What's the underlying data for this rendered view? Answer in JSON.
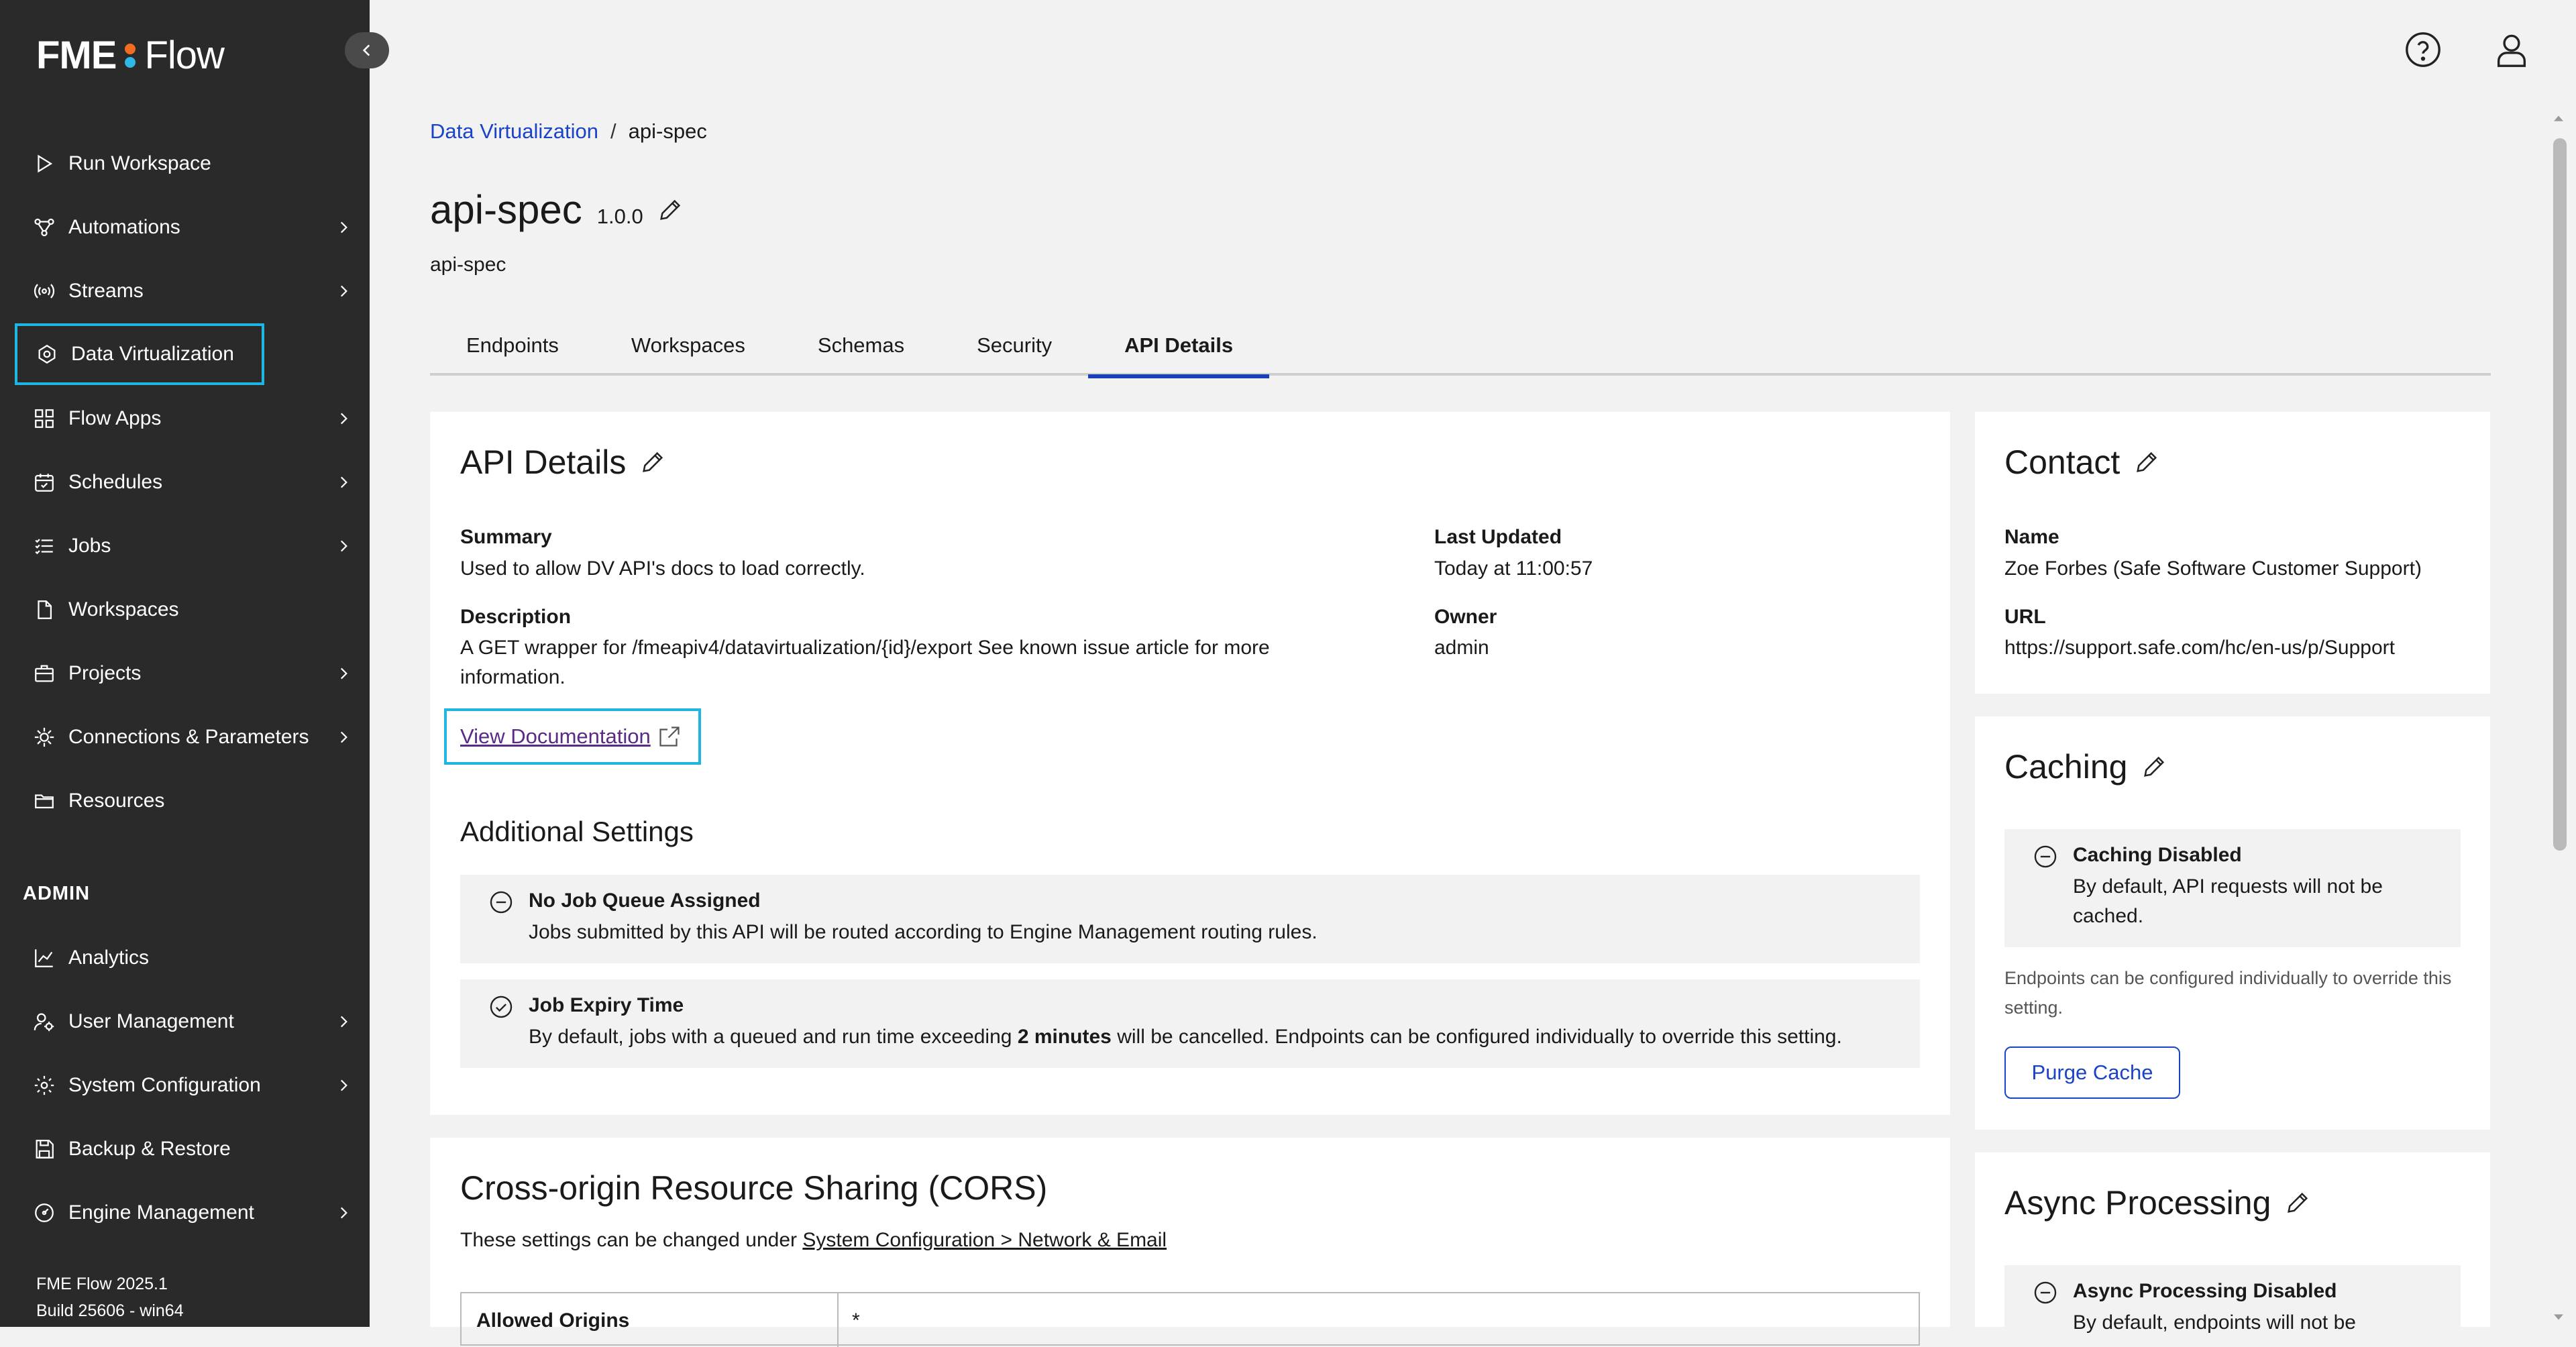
{
  "app": {
    "logo_left": "FME",
    "logo_right": "Flow"
  },
  "sidebar": {
    "items": [
      {
        "label": "Run Workspace",
        "icon": "play-icon",
        "chevron": false
      },
      {
        "label": "Automations",
        "icon": "automations-icon",
        "chevron": true
      },
      {
        "label": "Streams",
        "icon": "streams-icon",
        "chevron": true
      },
      {
        "label": "Data Virtualization",
        "icon": "data-virtualization-icon",
        "chevron": false,
        "active": true
      },
      {
        "label": "Flow Apps",
        "icon": "apps-icon",
        "chevron": true
      },
      {
        "label": "Schedules",
        "icon": "calendar-icon",
        "chevron": true
      },
      {
        "label": "Jobs",
        "icon": "list-icon",
        "chevron": true
      },
      {
        "label": "Workspaces",
        "icon": "file-icon",
        "chevron": false
      },
      {
        "label": "Projects",
        "icon": "briefcase-icon",
        "chevron": true
      },
      {
        "label": "Connections & Parameters",
        "icon": "connections-icon",
        "chevron": true
      },
      {
        "label": "Resources",
        "icon": "folder-icon",
        "chevron": false
      }
    ],
    "admin_heading": "ADMIN",
    "admin_items": [
      {
        "label": "Analytics",
        "icon": "chart-icon",
        "chevron": false
      },
      {
        "label": "User Management",
        "icon": "user-gear-icon",
        "chevron": true
      },
      {
        "label": "System Configuration",
        "icon": "gear-icon",
        "chevron": true
      },
      {
        "label": "Backup & Restore",
        "icon": "save-icon",
        "chevron": false
      },
      {
        "label": "Engine Management",
        "icon": "engine-icon",
        "chevron": true
      }
    ],
    "version_line1": "FME Flow 2025.1",
    "version_line2": "Build 25606 - win64"
  },
  "breadcrumb": {
    "parent": "Data Virtualization",
    "separator": "/",
    "current": "api-spec"
  },
  "header": {
    "title": "api-spec",
    "version": "1.0.0",
    "subtitle": "api-spec"
  },
  "tabs": [
    "Endpoints",
    "Workspaces",
    "Schemas",
    "Security",
    "API Details"
  ],
  "active_tab": "API Details",
  "api_details": {
    "title": "API Details",
    "summary_label": "Summary",
    "summary_value": "Used to allow DV API's docs to load correctly.",
    "description_label": "Description",
    "description_value_1": "A GET wrapper for /fmeapiv4/datavirtualization/{id}/export See known issue article for more",
    "description_value_2": "information.",
    "last_updated_label": "Last Updated",
    "last_updated_value": "Today at 11:00:57",
    "owner_label": "Owner",
    "owner_value": "admin",
    "doc_link": "View Documentation",
    "additional_heading": "Additional Settings",
    "queue_title": "No Job Queue Assigned",
    "queue_text": "Jobs submitted by this API will be routed according to Engine Management routing rules.",
    "expiry_title": "Job Expiry Time",
    "expiry_text_pre": "By default, jobs with a queued and run time exceeding ",
    "expiry_text_bold": "2 minutes",
    "expiry_text_post": " will be cancelled. Endpoints can be configured individually to override this setting."
  },
  "cors": {
    "title": "Cross-origin Resource Sharing (CORS)",
    "text": "These settings can be changed under ",
    "link": "System Configuration > Network & Email",
    "origins_label": "Allowed Origins",
    "origins_value": "*"
  },
  "contact": {
    "title": "Contact",
    "name_label": "Name",
    "name_value": "Zoe Forbes (Safe Software Customer Support)",
    "url_label": "URL",
    "url_value": "https://support.safe.com/hc/en-us/p/Support"
  },
  "caching": {
    "title": "Caching",
    "status_title": "Caching Disabled",
    "status_text_1": "By default, API requests will not be",
    "status_text_2": "cached.",
    "note_1": "Endpoints can be configured individually to override this",
    "note_2": "setting.",
    "purge_label": "Purge Cache"
  },
  "async": {
    "title": "Async Processing",
    "status_title": "Async Processing Disabled",
    "status_text": "By default, endpoints will not be"
  }
}
